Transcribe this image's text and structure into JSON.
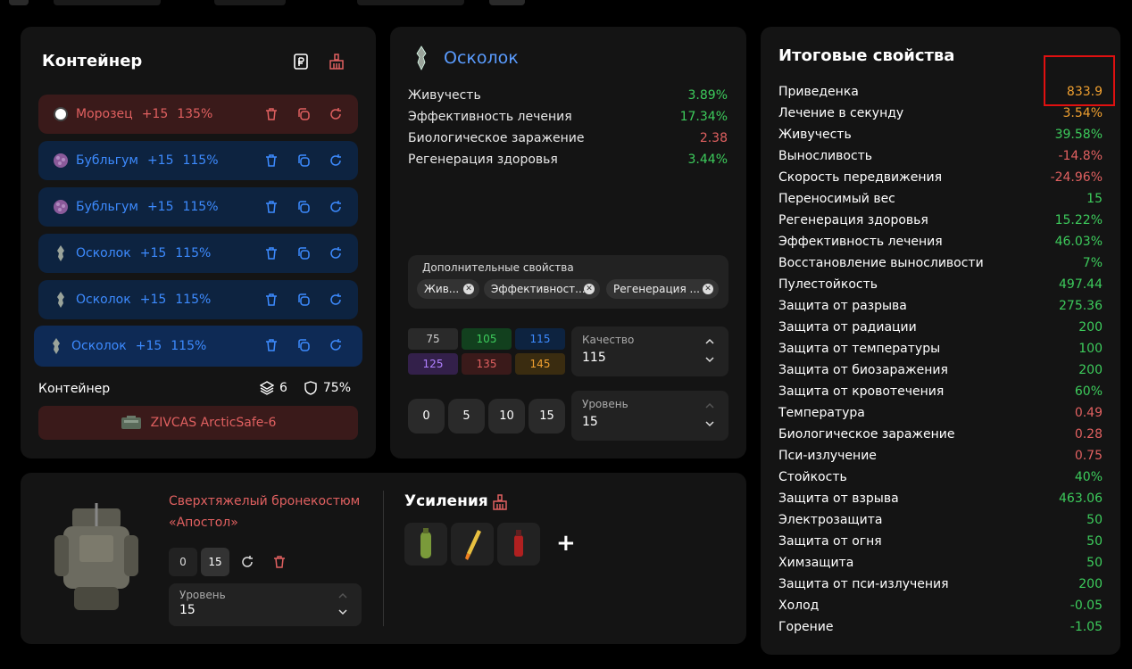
{
  "container": {
    "title": "Контейнер",
    "slots": [
      {
        "name": "Морозец",
        "level": "+15",
        "quality": "135%",
        "style": "red",
        "icon": "frost-orb-icon"
      },
      {
        "name": "Бубльгум",
        "level": "+15",
        "quality": "115%",
        "style": "blue",
        "icon": "bubblegum-icon"
      },
      {
        "name": "Бубльгум",
        "level": "+15",
        "quality": "115%",
        "style": "blue",
        "icon": "bubblegum-icon"
      },
      {
        "name": "Осколок",
        "level": "+15",
        "quality": "115%",
        "style": "blue",
        "icon": "shard-icon"
      },
      {
        "name": "Осколок",
        "level": "+15",
        "quality": "115%",
        "style": "blue",
        "icon": "shard-icon"
      },
      {
        "name": "Осколок",
        "level": "+15",
        "quality": "115%",
        "style": "selected",
        "icon": "shard-icon"
      }
    ],
    "footer_label": "Контейнер",
    "slots_count": "6",
    "protection": "75%",
    "case_name": "ZIVCAS ArcticSafe-6"
  },
  "artifact": {
    "title": "Осколок",
    "stats": [
      {
        "name": "Живучесть",
        "value": "3.89%",
        "color": "green"
      },
      {
        "name": "Эффективность лечения",
        "value": "17.34%",
        "color": "green"
      },
      {
        "name": "Биологическое заражение",
        "value": "2.38",
        "color": "red"
      },
      {
        "name": "Регенерация здоровья",
        "value": "3.44%",
        "color": "green"
      }
    ],
    "extra_label": "Дополнительные свойства",
    "extra_chips": [
      "Жив...",
      "Эффективност...",
      "Регенерация ..."
    ],
    "quality_buttons": [
      {
        "label": "75",
        "bg": "#2a2a2a",
        "fg": "#ccc"
      },
      {
        "label": "105",
        "bg": "#12401e",
        "fg": "#3dcc5c"
      },
      {
        "label": "115",
        "bg": "#0d2340",
        "fg": "#3d8bff"
      },
      {
        "label": "125",
        "bg": "#33204a",
        "fg": "#b080ff"
      },
      {
        "label": "135",
        "bg": "#3a1a1a",
        "fg": "#e06060"
      },
      {
        "label": "145",
        "bg": "#3a2c10",
        "fg": "#f0a030"
      }
    ],
    "quality_label": "Качество",
    "quality_value": "115",
    "level_buttons": [
      "0",
      "5",
      "10",
      "15"
    ],
    "level_label": "Уровень",
    "level_value": "15"
  },
  "armor": {
    "name": "Сверхтяжелый бронекостюм «Апостол»",
    "btn_zero": "0",
    "btn_fifteen": "15",
    "level_label": "Уровень",
    "level_value": "15",
    "boosts_title": "Усиления",
    "boost_slots": [
      "green-bottle-icon",
      "yellow-syringe-icon",
      "red-bottle-icon"
    ],
    "add_label": "+"
  },
  "totals": {
    "title": "Итоговые свойства",
    "rows": [
      {
        "name": "Приведенка",
        "value": "833.9",
        "color": "orange"
      },
      {
        "name": "Лечение в секунду",
        "value": "3.54%",
        "color": "orange"
      },
      {
        "name": "Живучесть",
        "value": "39.58%",
        "color": "green"
      },
      {
        "name": "Выносливость",
        "value": "-14.8%",
        "color": "red"
      },
      {
        "name": "Скорость передвижения",
        "value": "-24.96%",
        "color": "red"
      },
      {
        "name": "Переносимый вес",
        "value": "15",
        "color": "green"
      },
      {
        "name": "Регенерация здоровья",
        "value": "15.22%",
        "color": "green"
      },
      {
        "name": "Эффективность лечения",
        "value": "46.03%",
        "color": "green"
      },
      {
        "name": "Восстановление выносливости",
        "value": "7%",
        "color": "green"
      },
      {
        "name": "Пулестойкость",
        "value": "497.44",
        "color": "green"
      },
      {
        "name": "Защита от разрыва",
        "value": "275.36",
        "color": "green"
      },
      {
        "name": "Защита от радиации",
        "value": "200",
        "color": "green"
      },
      {
        "name": "Защита от температуры",
        "value": "100",
        "color": "green"
      },
      {
        "name": "Защита от биозаражения",
        "value": "200",
        "color": "green"
      },
      {
        "name": "Защита от кровотечения",
        "value": "60%",
        "color": "green"
      },
      {
        "name": "Температура",
        "value": "0.49",
        "color": "red"
      },
      {
        "name": "Биологическое заражение",
        "value": "0.28",
        "color": "red"
      },
      {
        "name": "Пси-излучение",
        "value": "0.75",
        "color": "red"
      },
      {
        "name": "Стойкость",
        "value": "40%",
        "color": "green"
      },
      {
        "name": "Защита от взрыва",
        "value": "463.06",
        "color": "green"
      },
      {
        "name": "Электрозащита",
        "value": "50",
        "color": "green"
      },
      {
        "name": "Защита от огня",
        "value": "50",
        "color": "green"
      },
      {
        "name": "Химзащита",
        "value": "50",
        "color": "green"
      },
      {
        "name": "Защита от пси-излучения",
        "value": "200",
        "color": "green"
      },
      {
        "name": "Холод",
        "value": "-0.05",
        "color": "green"
      },
      {
        "name": "Горение",
        "value": "-1.05",
        "color": "green"
      }
    ]
  },
  "colors": {
    "green": "#3dcc5c",
    "red": "#e06060",
    "orange": "#f0a030",
    "accent_blue": "#3d8bff"
  }
}
